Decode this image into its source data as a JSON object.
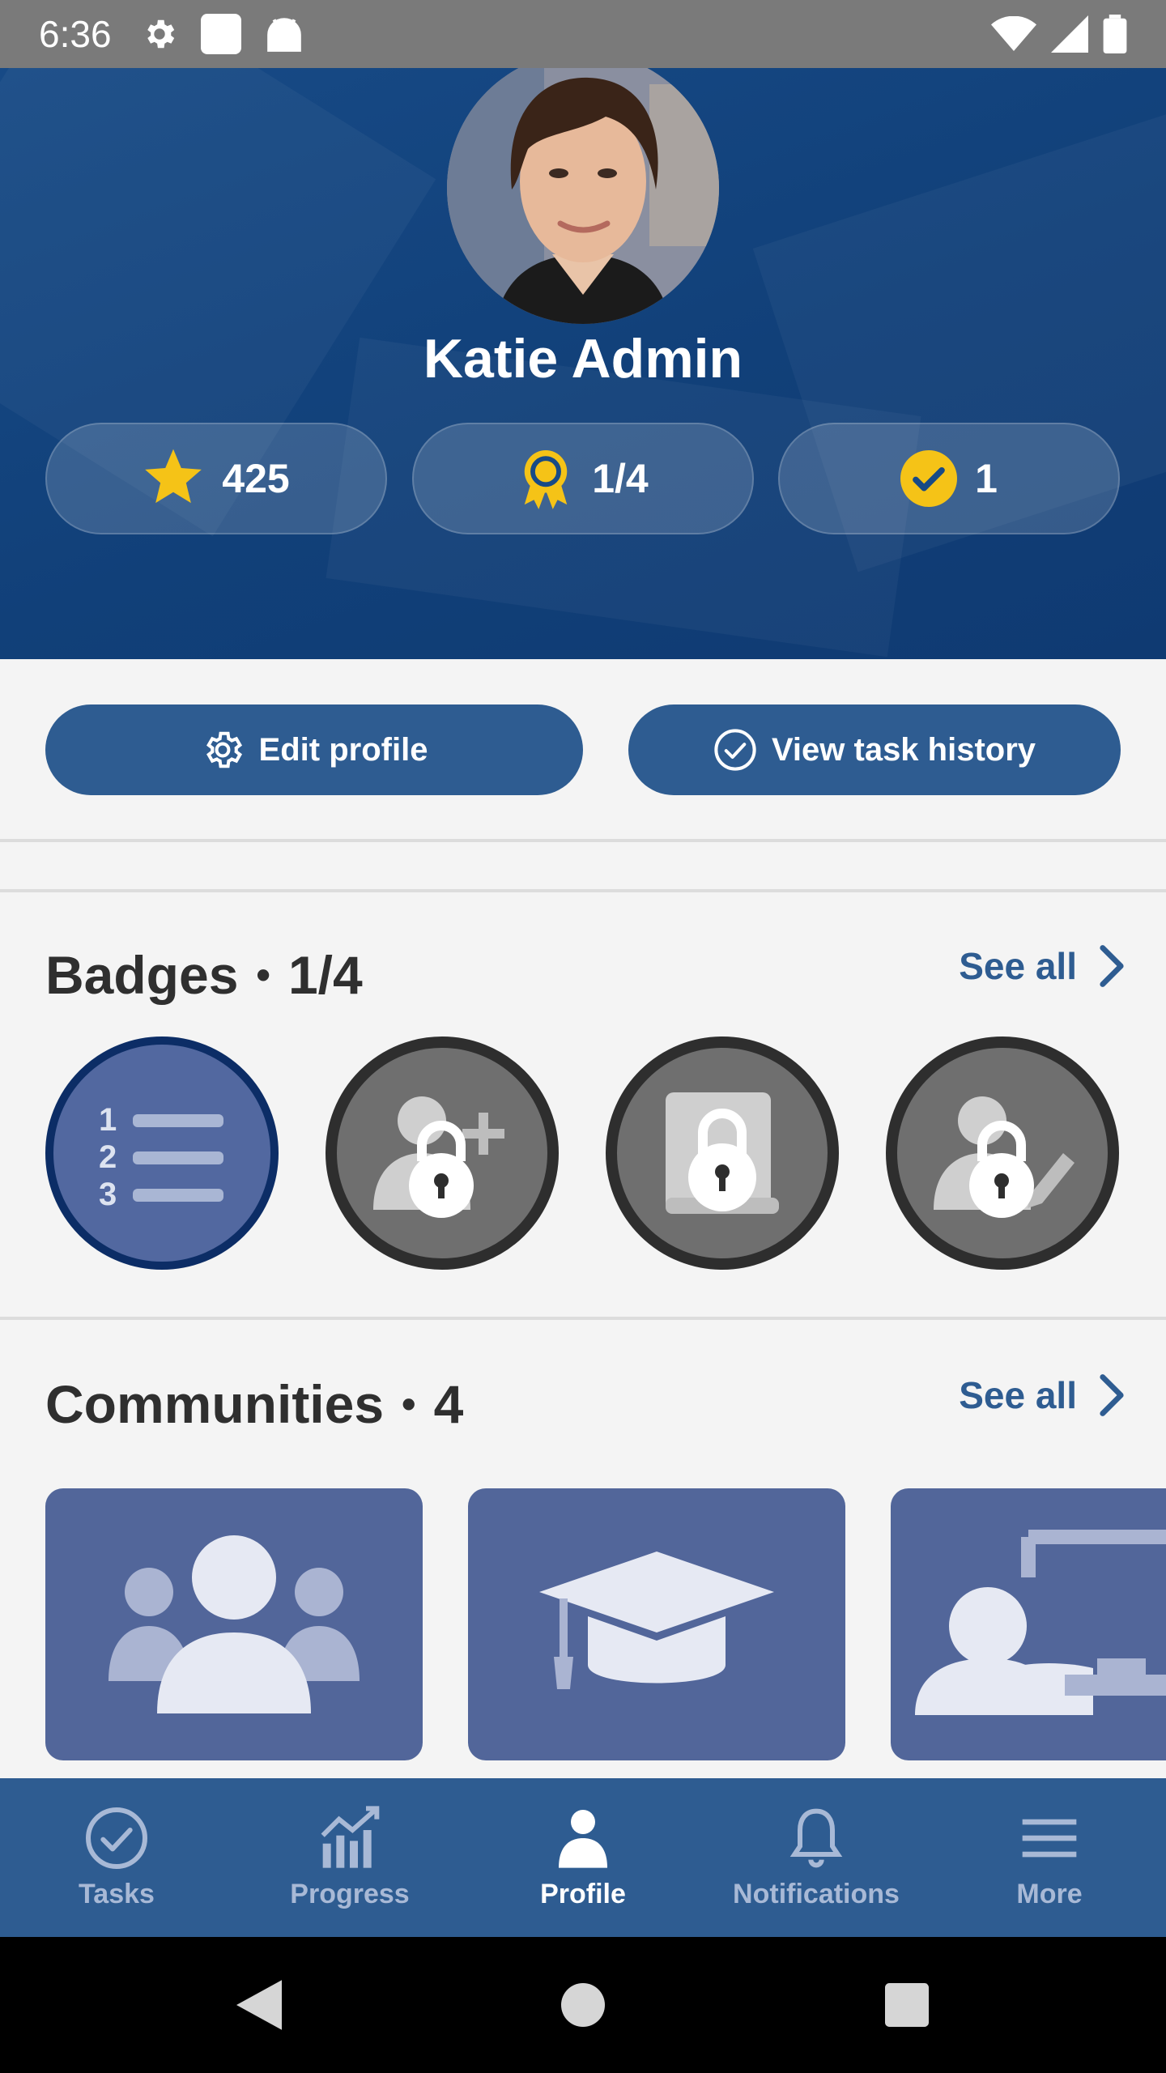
{
  "status_bar": {
    "time": "6:36"
  },
  "header": {
    "user_name": "Katie Admin"
  },
  "stats": {
    "points": "425",
    "badges": "1/4",
    "completed": "1"
  },
  "actions": {
    "edit_profile": "Edit profile",
    "view_task_history": "View task history"
  },
  "badges_section": {
    "title": "Badges",
    "count": "1/4",
    "see_all": "See all"
  },
  "communities_section": {
    "title": "Communities",
    "count": "4",
    "see_all": "See all"
  },
  "bottom_nav": {
    "items": [
      {
        "label": "Tasks",
        "icon": "check-circle-icon"
      },
      {
        "label": "Progress",
        "icon": "chart-icon"
      },
      {
        "label": "Profile",
        "icon": "person-icon",
        "active": true
      },
      {
        "label": "Notifications",
        "icon": "bell-icon"
      },
      {
        "label": "More",
        "icon": "menu-icon"
      }
    ]
  },
  "colors": {
    "primary": "#2e5c91",
    "header": "#174a86",
    "accent": "#f5c317",
    "card": "#52669a",
    "locked": "#6f6f6f"
  }
}
